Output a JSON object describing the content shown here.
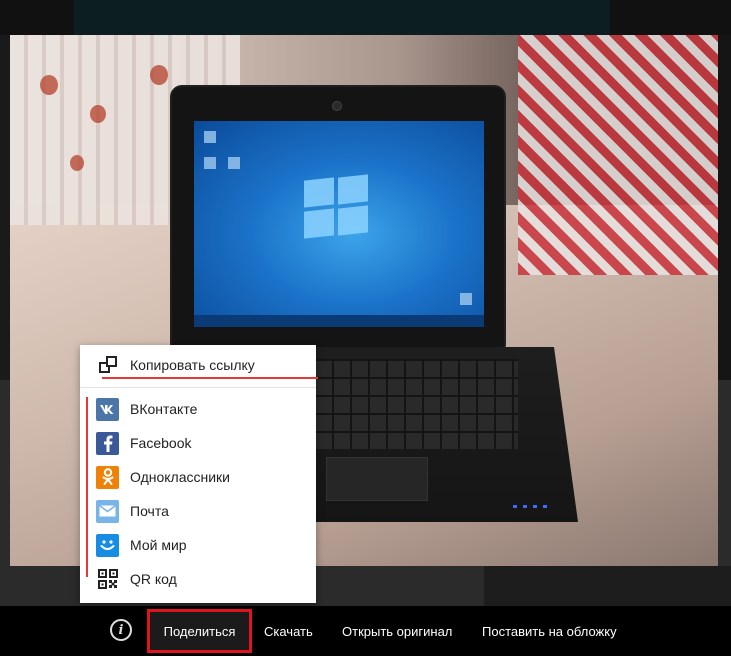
{
  "share_menu": {
    "copy_link": {
      "label": "Копировать ссылку",
      "icon": "copy-link-icon"
    },
    "items": [
      {
        "label": "ВКонтакте",
        "icon": "vk-icon",
        "color": "#4a76a8",
        "glyph": "vk"
      },
      {
        "label": "Facebook",
        "icon": "facebook-icon",
        "color": "#3b5998",
        "glyph": "f"
      },
      {
        "label": "Одноклассники",
        "icon": "odnoklassniki-icon",
        "color": "#ee8208",
        "glyph": "ok"
      },
      {
        "label": "Почта",
        "icon": "mail-icon",
        "color": "#78b4e8",
        "glyph": "✉"
      },
      {
        "label": "Мой мир",
        "icon": "moi-mir-icon",
        "color": "#168de2",
        "glyph": "☺"
      },
      {
        "label": "QR код",
        "icon": "qr-code-icon",
        "color": "#ffffff",
        "glyph": "▦"
      }
    ],
    "highlight_color": "#e53935"
  },
  "toolbar": {
    "info_glyph": "i",
    "share_label": "Поделиться",
    "download_label": "Скачать",
    "open_original_label": "Открыть оригинал",
    "set_cover_label": "Поставить на обложку",
    "share_highlight_color": "#e0141e"
  }
}
